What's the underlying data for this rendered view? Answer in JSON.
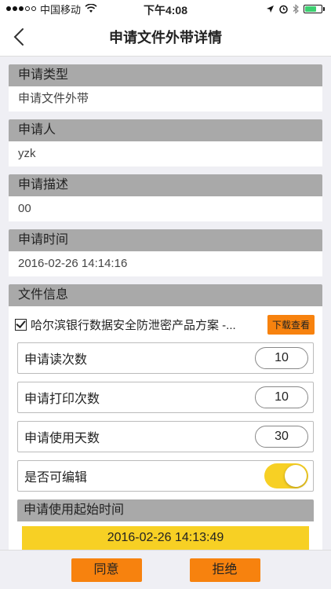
{
  "status_bar": {
    "carrier": "中国移动",
    "time": "下午4:08"
  },
  "nav": {
    "title": "申请文件外带详情"
  },
  "sections": [
    {
      "header": "申请类型",
      "value": "申请文件外带"
    },
    {
      "header": "申请人",
      "value": "yzk"
    },
    {
      "header": "申请描述",
      "value": "00"
    },
    {
      "header": "申请时间",
      "value": "2016-02-26 14:14:16"
    }
  ],
  "file_info": {
    "header": "文件信息",
    "file_name": "哈尔滨银行数据安全防泄密产品方案 -...",
    "download_label": "下载查看",
    "fields": [
      {
        "label": "申请读次数",
        "value": "10"
      },
      {
        "label": "申请打印次数",
        "value": "10"
      },
      {
        "label": "申请使用天数",
        "value": "30"
      }
    ],
    "editable_label": "是否可编辑",
    "editable": true,
    "start_time_label": "申请使用起始时间",
    "start_time_value": "2016-02-26 14:13:49"
  },
  "actions": {
    "approve": "同意",
    "reject": "拒绝"
  },
  "colors": {
    "accent_orange": "#f7820e",
    "accent_yellow": "#f7d024",
    "header_gray": "#a9a9a9"
  }
}
